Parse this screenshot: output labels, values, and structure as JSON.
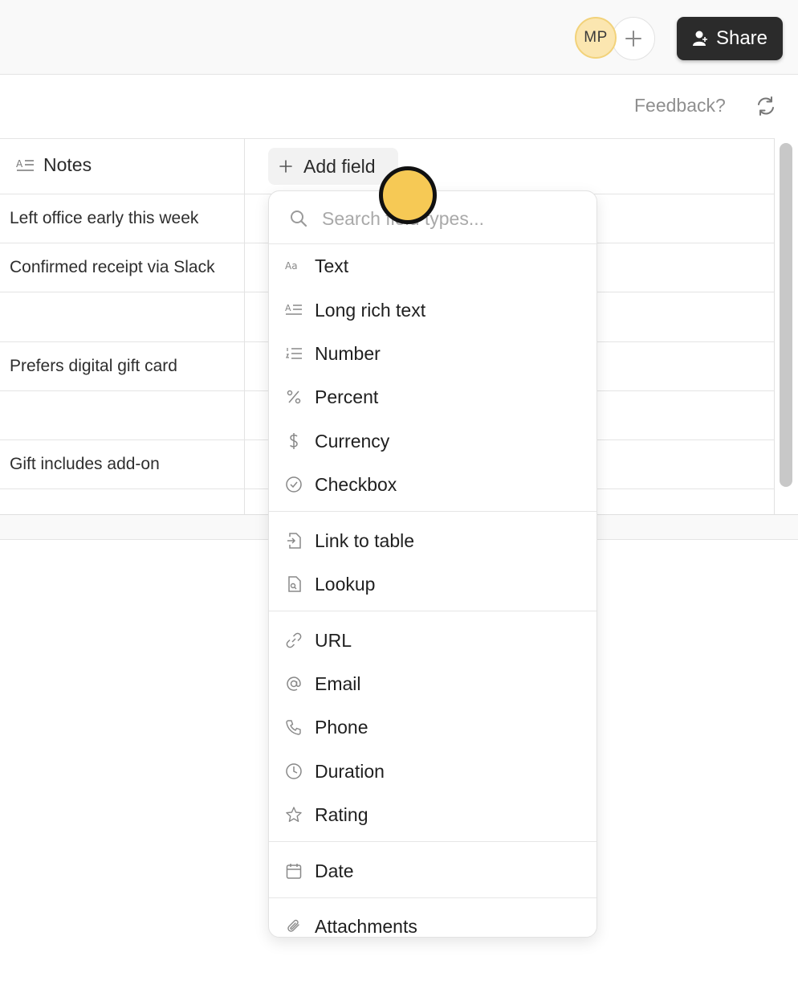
{
  "header": {
    "avatar_initials": "MP",
    "share_label": "Share"
  },
  "toolbar": {
    "feedback_label": "Feedback?"
  },
  "table": {
    "notes_header": "Notes",
    "add_field_label": "Add field",
    "rows": [
      "Left office early this week",
      "Confirmed receipt via Slack",
      "",
      "Prefers digital gift card",
      "",
      "Gift includes add-on",
      ""
    ]
  },
  "dropdown": {
    "search_placeholder": "Search field types...",
    "groups": [
      [
        {
          "label": "Text",
          "icon": "text-aa-icon"
        },
        {
          "label": "Long rich text",
          "icon": "long-text-icon"
        },
        {
          "label": "Number",
          "icon": "number-list-icon"
        },
        {
          "label": "Percent",
          "icon": "percent-icon"
        },
        {
          "label": "Currency",
          "icon": "dollar-icon"
        },
        {
          "label": "Checkbox",
          "icon": "check-circle-icon"
        }
      ],
      [
        {
          "label": "Link to table",
          "icon": "link-table-icon"
        },
        {
          "label": "Lookup",
          "icon": "lookup-icon"
        }
      ],
      [
        {
          "label": "URL",
          "icon": "link-icon"
        },
        {
          "label": "Email",
          "icon": "at-icon"
        },
        {
          "label": "Phone",
          "icon": "phone-icon"
        },
        {
          "label": "Duration",
          "icon": "clock-icon"
        },
        {
          "label": "Rating",
          "icon": "star-icon"
        }
      ],
      [
        {
          "label": "Date",
          "icon": "calendar-icon"
        }
      ],
      [
        {
          "label": "Attachments",
          "icon": "paperclip-icon"
        }
      ]
    ]
  },
  "colors": {
    "accent_cursor": "#f6c955",
    "share_bg": "#2b2b2b",
    "avatar_bg": "#fbe6b0"
  }
}
